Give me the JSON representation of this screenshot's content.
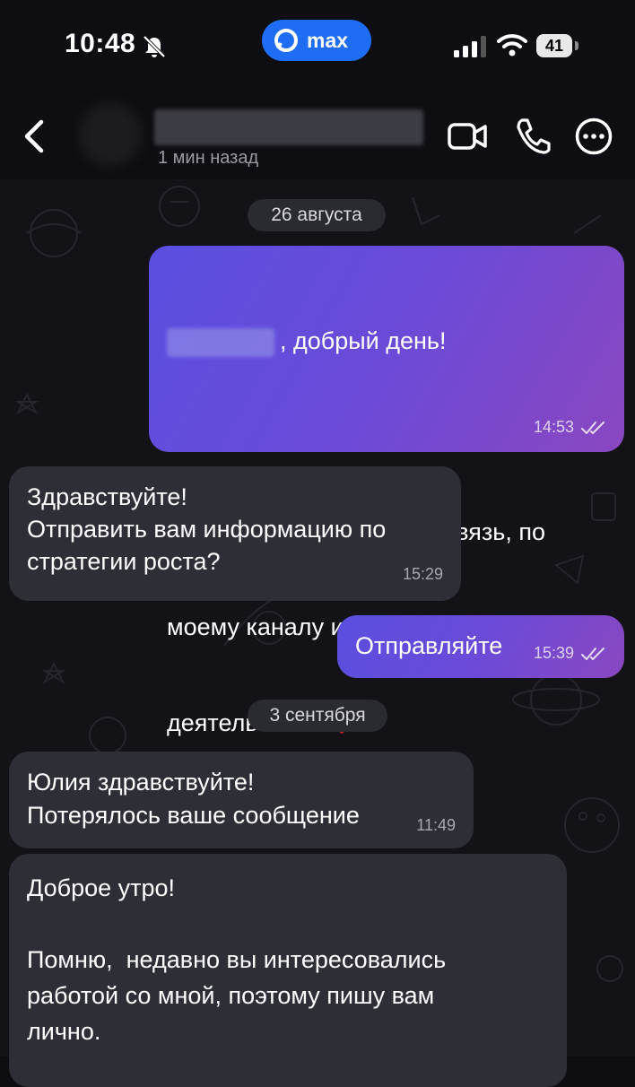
{
  "status_bar": {
    "time": "10:48",
    "app_name": "max",
    "battery": "41"
  },
  "header": {
    "last_seen": "1 мин назад"
  },
  "dates": [
    "26 августа",
    "3 сентября"
  ],
  "messages": [
    {
      "direction": "out",
      "lines": [
        ", добрый день!",
        "",
        "Благодарю за обратную связь, по",
        "моему каналу и в целом, по моей",
        "деятельности"
      ],
      "emoji": "heart",
      "time": "14:53",
      "status": "read"
    },
    {
      "direction": "in",
      "text": "Здравствуйте!\nОтправить вам информацию по\nстратегии роста?",
      "time": "15:29"
    },
    {
      "direction": "out",
      "text": "Отправляйте",
      "time": "15:39",
      "status": "read"
    },
    {
      "direction": "in",
      "text": "Юлия здравствуйте!\nПотерялось ваше сообщение",
      "time": "11:49"
    },
    {
      "direction": "in",
      "text": "Доброе утро!\n\nПомню,  недавно вы интересовались\nработой со мной, поэтому пишу вам\nлично."
    }
  ],
  "colors": {
    "accent": "#1f6df5",
    "outgoing_start": "#5a4fe0",
    "outgoing_end": "#8a47c0",
    "incoming": "#2e2e37"
  },
  "icons": [
    "mute-icon",
    "max-logo-icon",
    "signal-icon",
    "wifi-icon",
    "back-icon",
    "video-call-icon",
    "phone-icon",
    "more-icon",
    "heart-icon",
    "double-check-icon"
  ]
}
